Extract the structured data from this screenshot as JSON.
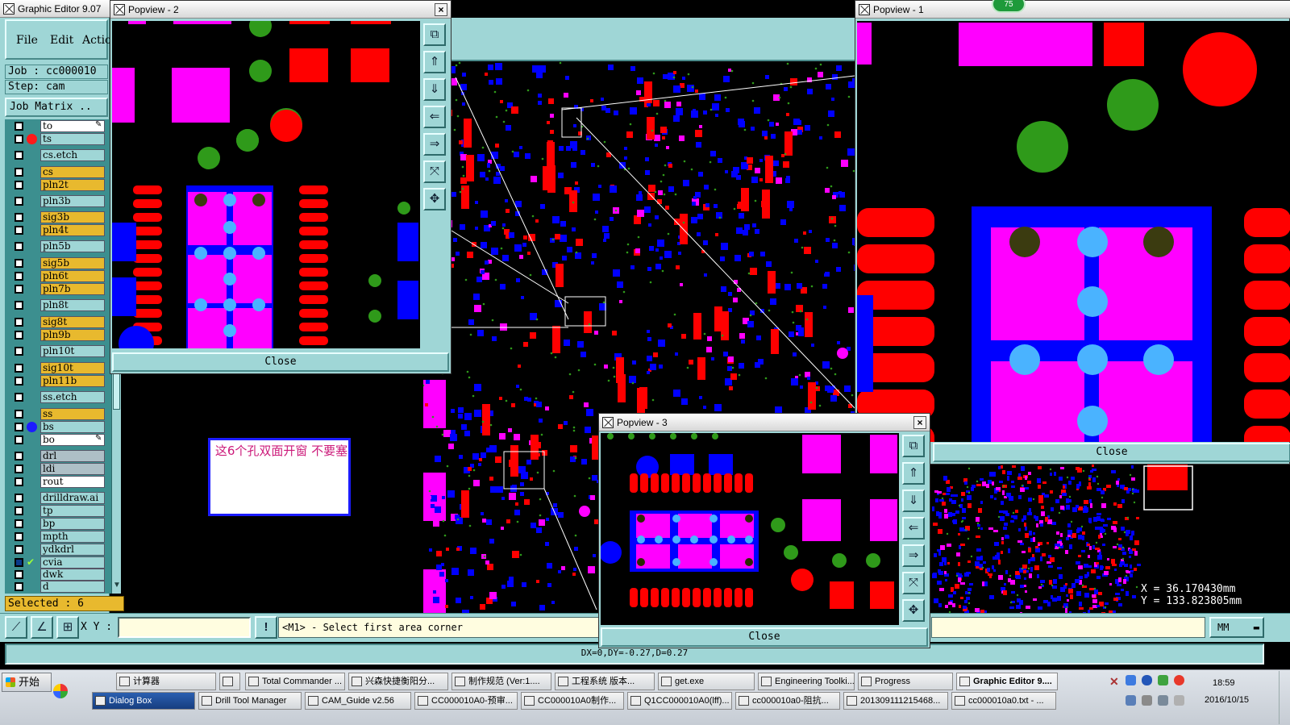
{
  "main_window": {
    "title": "Graphic Editor 9.07",
    "menu": [
      "File",
      "Edit",
      "Actio"
    ],
    "job_label": "Job : cc000010",
    "step_label": "Step: cam",
    "job_matrix_label": "Job Matrix ..",
    "selected_label": "Selected : 6",
    "xy_label": "X Y :",
    "status_message": "<M1> - Select first area corner",
    "bottom_status": "DX=0,DY=-0.27,D=0.27",
    "units": "MM",
    "coord_x": "X  =  36.170430mm",
    "coord_y": "Y  = 133.823805mm",
    "annotation_note": "这6个孔双面开窗  不要塞"
  },
  "layers": [
    {
      "name": "to",
      "color": "white",
      "flag": "edit"
    },
    {
      "name": "ts",
      "color": "teal",
      "flag": "dot-red"
    },
    {
      "name": "cs.etch",
      "color": "teal",
      "flag": ""
    },
    {
      "name": "cs",
      "color": "gold",
      "flag": ""
    },
    {
      "name": "pln2t",
      "color": "gold",
      "flag": ""
    },
    {
      "name": "pln3b",
      "color": "teal",
      "flag": ""
    },
    {
      "name": "sig3b",
      "color": "gold",
      "flag": ""
    },
    {
      "name": "pln4t",
      "color": "gold",
      "flag": ""
    },
    {
      "name": "pln5b",
      "color": "teal",
      "flag": ""
    },
    {
      "name": "sig5b",
      "color": "gold",
      "flag": ""
    },
    {
      "name": "pln6t",
      "color": "gold",
      "flag": ""
    },
    {
      "name": "pln7b",
      "color": "gold",
      "flag": ""
    },
    {
      "name": "pln8t",
      "color": "teal",
      "flag": ""
    },
    {
      "name": "sig8t",
      "color": "gold",
      "flag": ""
    },
    {
      "name": "pln9b",
      "color": "gold",
      "flag": ""
    },
    {
      "name": "pln10t",
      "color": "teal",
      "flag": ""
    },
    {
      "name": "sig10t",
      "color": "gold",
      "flag": ""
    },
    {
      "name": "pln11b",
      "color": "gold",
      "flag": ""
    },
    {
      "name": "ss.etch",
      "color": "teal",
      "flag": ""
    },
    {
      "name": "ss",
      "color": "gold",
      "flag": ""
    },
    {
      "name": "bs",
      "color": "teal",
      "flag": "dot-blue"
    },
    {
      "name": "bo",
      "color": "white",
      "flag": "edit"
    },
    {
      "name": "drl",
      "color": "grey",
      "flag": ""
    },
    {
      "name": "ldi",
      "color": "grey",
      "flag": ""
    },
    {
      "name": "rout",
      "color": "white",
      "flag": ""
    },
    {
      "name": "drilldraw.ai",
      "color": "teal",
      "flag": ""
    },
    {
      "name": "tp",
      "color": "teal",
      "flag": ""
    },
    {
      "name": "bp",
      "color": "teal",
      "flag": ""
    },
    {
      "name": "mpth",
      "color": "teal",
      "flag": ""
    },
    {
      "name": "ydkdrl",
      "color": "teal",
      "flag": ""
    },
    {
      "name": "cvia",
      "color": "teal",
      "flag": "check"
    },
    {
      "name": "dwk",
      "color": "teal",
      "flag": ""
    },
    {
      "name": "d",
      "color": "teal",
      "flag": ""
    }
  ],
  "popviews": {
    "p2": {
      "title": "Popview - 2",
      "close": "Close"
    },
    "p1": {
      "title": "Popview - 1",
      "close": "Close",
      "badge": "75"
    },
    "p3": {
      "title": "Popview - 3",
      "close": "Close"
    }
  },
  "taskbar": {
    "start": "开始",
    "row1": [
      "计算器",
      "",
      "Total Commander ...",
      "兴森快捷衡阳分...",
      "制作规范 (Ver:1....",
      "工程系统   版本...",
      "get.exe",
      "Engineering Toolki...",
      "Progress",
      "Graphic Editor 9...."
    ],
    "row2": [
      "Dialog Box",
      "Drill Tool Manager",
      "CAM_Guide v2.56",
      "CC000010A0-预审...",
      "CC000010A0制作...",
      "Q1CC000010A0(lff)...",
      "cc000010a0-阻抗...",
      "20130911121546​8...",
      "cc000010a0.txt - ..."
    ],
    "time": "18:59",
    "date": "2016/10/15"
  },
  "colors": {
    "accent": "#9fd6d6",
    "gold": "#e8b92e",
    "pad": "#ff0000",
    "smd": "#ff00ff",
    "via": "#0000ff",
    "drill": "#4ab3ff",
    "green": "#2f9a1a"
  }
}
